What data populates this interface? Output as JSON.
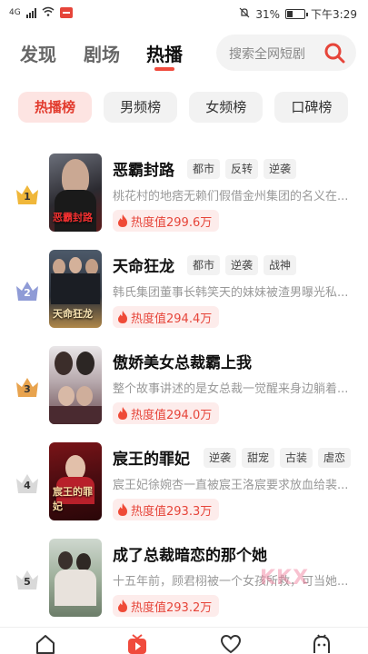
{
  "status": {
    "left_label": "4G",
    "battery": "31%",
    "time": "下午3:29"
  },
  "nav": {
    "tabs": [
      {
        "label": "发现"
      },
      {
        "label": "剧场"
      },
      {
        "label": "热播"
      }
    ],
    "active_tab": "热播",
    "search_placeholder": "搜索全网短剧"
  },
  "chips": [
    "热播榜",
    "男频榜",
    "女频榜",
    "口碑榜"
  ],
  "active_chip": "热播榜",
  "colors": {
    "accent": "#f04b3d",
    "chip_active_bg": "#fde4e2",
    "gold": "#f0b73a",
    "silver": "#8f9bd6",
    "bronze": "#e8a34e",
    "plain": "#d9d9d9"
  },
  "list": [
    {
      "rank": "1",
      "title": "恶霸封路",
      "tags": [
        "都市",
        "反转",
        "逆袭"
      ],
      "desc": "桃花村的地痞无赖们假借金州集团的名义在...",
      "heat": "热度值299.6万",
      "poster_caption": "恶霸封路"
    },
    {
      "rank": "2",
      "title": "天命狂龙",
      "tags": [
        "都市",
        "逆袭",
        "战神"
      ],
      "desc": "韩氏集团董事长韩笑天的妹妹被渣男曝光私...",
      "heat": "热度值294.4万",
      "poster_caption": "天命狂龙"
    },
    {
      "rank": "3",
      "title": "傲娇美女总裁霸上我",
      "tags": [],
      "desc": "整个故事讲述的是女总裁一觉醒来身边躺着...",
      "heat": "热度值294.0万",
      "poster_caption": ""
    },
    {
      "rank": "4",
      "title": "宸王的罪妃",
      "tags": [
        "逆袭",
        "甜宠",
        "古装",
        "虐恋"
      ],
      "desc": "宸王妃徐婉杏一直被宸王洛宸要求放血给裴...",
      "heat": "热度值293.3万",
      "poster_caption": "宸王的罪妃"
    },
    {
      "rank": "5",
      "title": "成了总裁暗恋的那个她",
      "tags": [],
      "desc": "十五年前，顾君栩被一个女孩所救，可当她...",
      "heat": "热度值293.2万",
      "poster_caption": ""
    }
  ],
  "watermark": "KKX",
  "bottom_nav": [
    "home-icon",
    "play-icon",
    "heart-icon",
    "mine-icon"
  ]
}
